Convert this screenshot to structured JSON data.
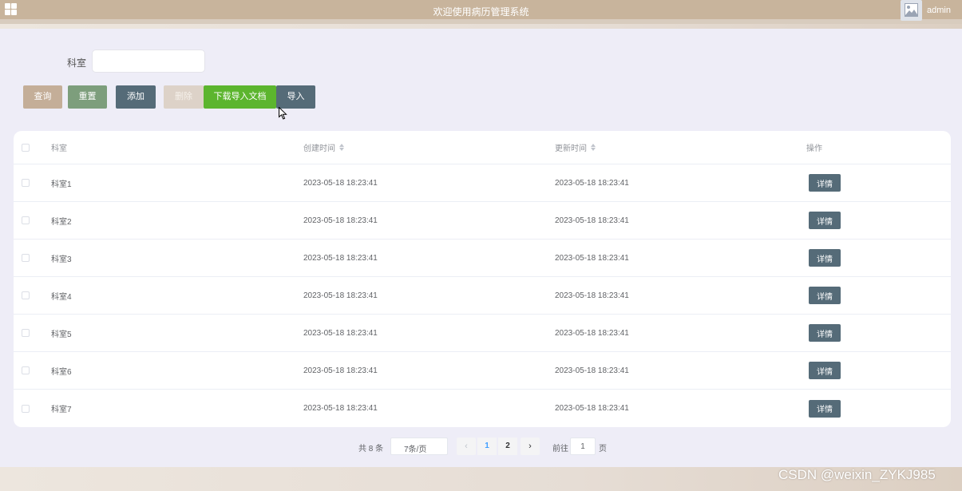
{
  "header": {
    "title": "欢迎使用病历管理系统",
    "user": "admin"
  },
  "filter": {
    "label": "科室",
    "value": "",
    "placeholder": ""
  },
  "toolbar": {
    "query_label": "查询",
    "reset_label": "重置",
    "add_label": "添加",
    "delete_label": "删除",
    "download_label": "下载导入文档",
    "import_label": "导入"
  },
  "table": {
    "columns": [
      "科室",
      "创建时间",
      "更新时间",
      "操作"
    ],
    "rows": [
      {
        "dept": "科室1",
        "created": "2023-05-18 18:23:41",
        "updated": "2023-05-18 18:23:41",
        "action": "详情"
      },
      {
        "dept": "科室2",
        "created": "2023-05-18 18:23:41",
        "updated": "2023-05-18 18:23:41",
        "action": "详情"
      },
      {
        "dept": "科室3",
        "created": "2023-05-18 18:23:41",
        "updated": "2023-05-18 18:23:41",
        "action": "详情"
      },
      {
        "dept": "科室4",
        "created": "2023-05-18 18:23:41",
        "updated": "2023-05-18 18:23:41",
        "action": "详情"
      },
      {
        "dept": "科室5",
        "created": "2023-05-18 18:23:41",
        "updated": "2023-05-18 18:23:41",
        "action": "详情"
      },
      {
        "dept": "科室6",
        "created": "2023-05-18 18:23:41",
        "updated": "2023-05-18 18:23:41",
        "action": "详情"
      },
      {
        "dept": "科室7",
        "created": "2023-05-18 18:23:41",
        "updated": "2023-05-18 18:23:41",
        "action": "详情"
      }
    ]
  },
  "pagination": {
    "total_text": "共 8 条",
    "page_size": "7条/页",
    "pages": [
      "1",
      "2"
    ],
    "current_page": "1",
    "goto_label": "前往",
    "goto_value": "1",
    "page_unit": "页"
  },
  "watermark": "CSDN @weixin_ZYKJ985",
  "colors": {
    "topbar": "#c8b49c",
    "query": "#c4ae98",
    "reset": "#7d9e7c",
    "primary": "#556b78",
    "download": "#5cb52e",
    "active_page": "#409eff"
  },
  "icons": [
    "grid-menu-icon",
    "avatar-image-icon",
    "sort-caret-icon",
    "chevron-left-icon",
    "chevron-right-icon",
    "chevron-down-icon",
    "mouse-cursor-icon"
  ]
}
